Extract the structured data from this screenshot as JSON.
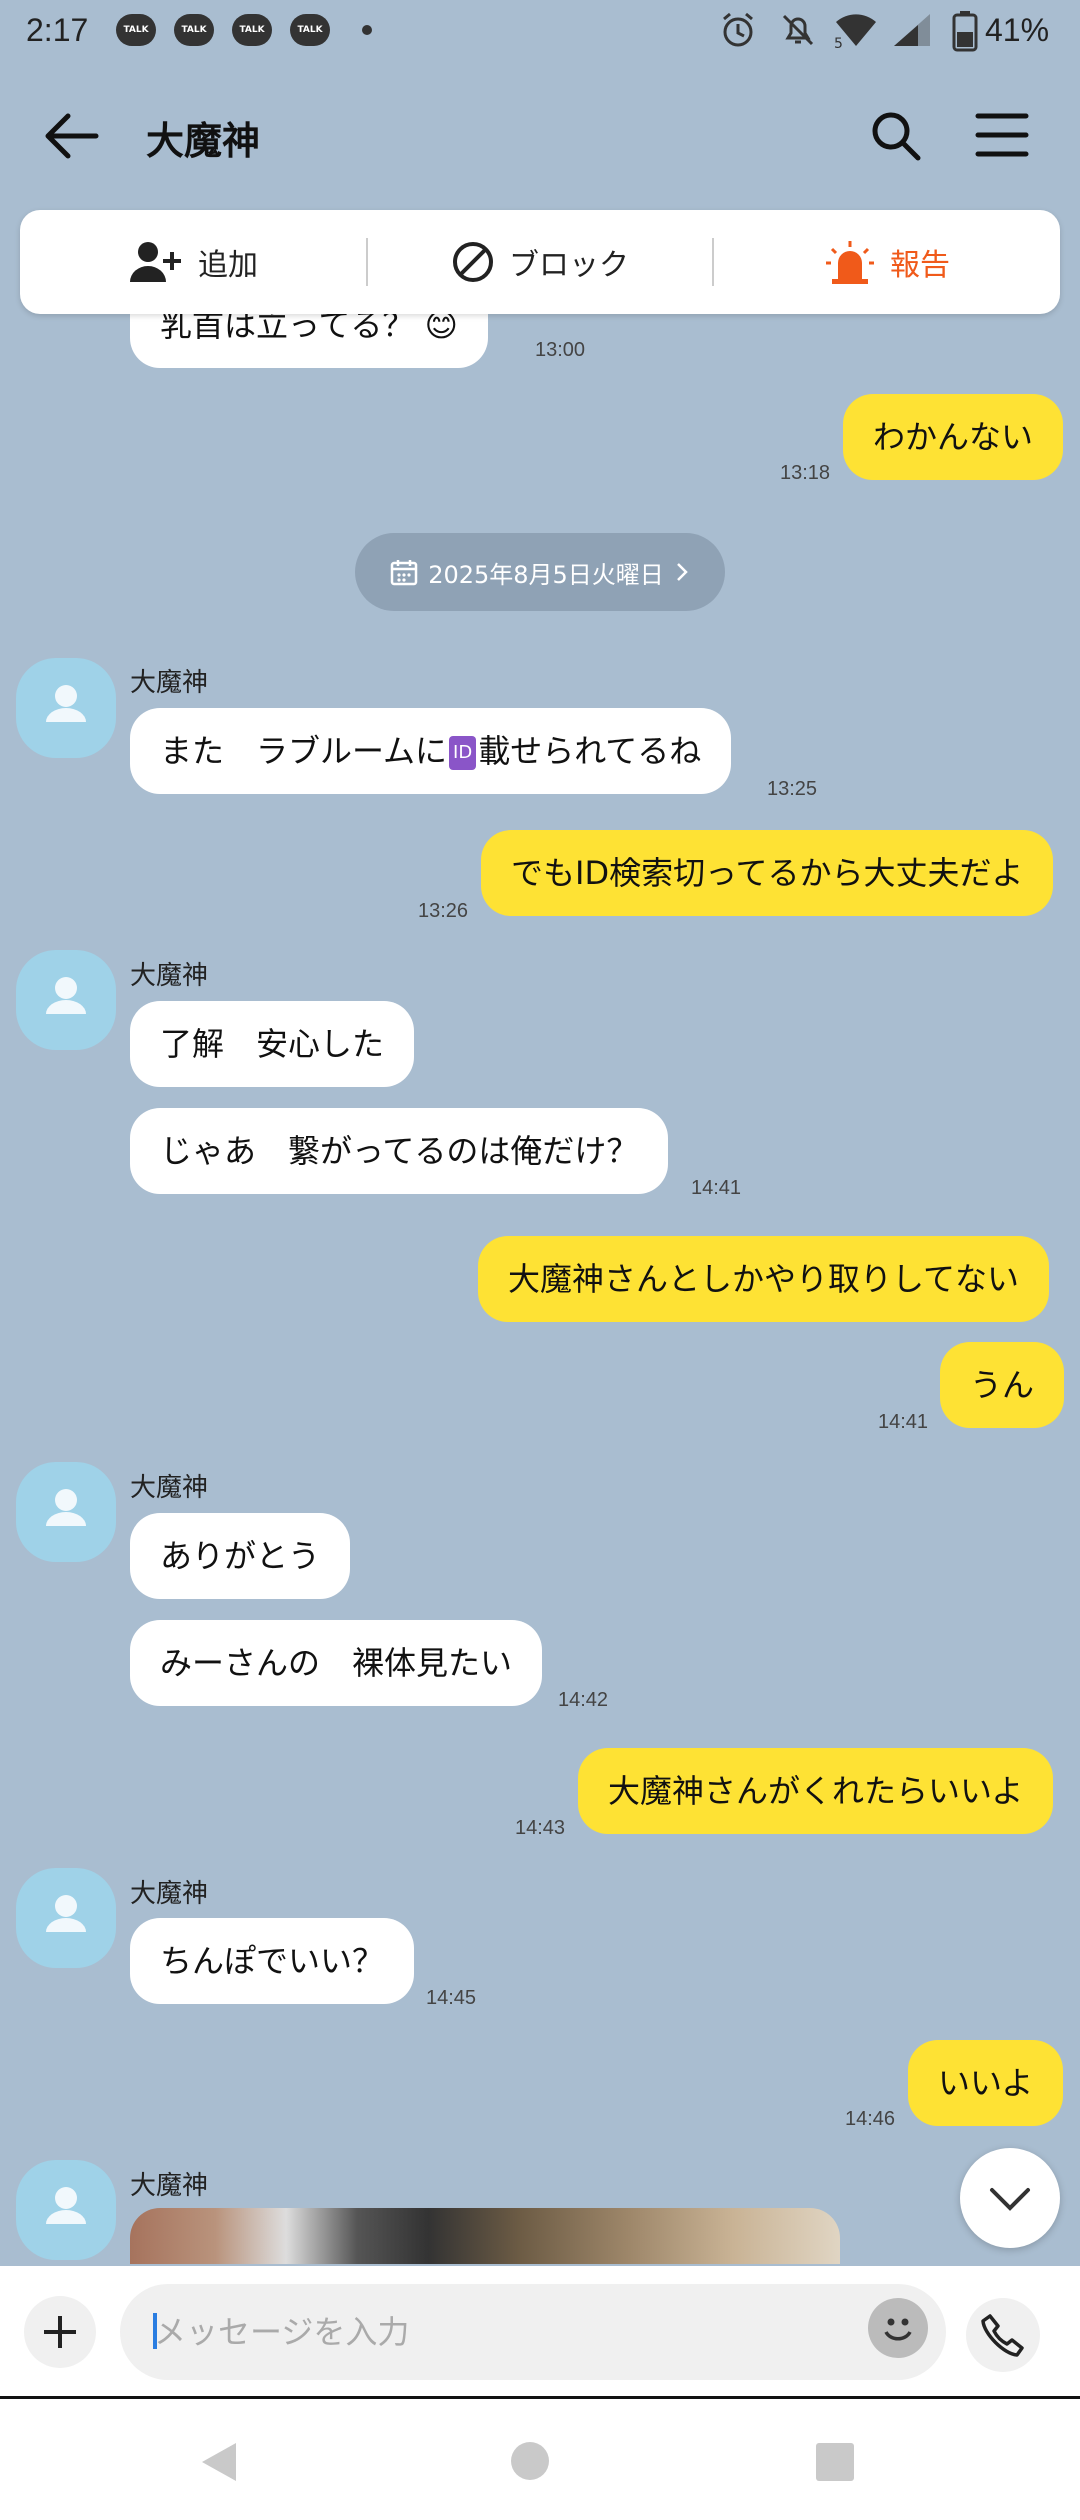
{
  "status": {
    "time": "2:17",
    "talk_label": "TALK",
    "battery": "41%"
  },
  "header": {
    "title": "大魔神"
  },
  "actions": {
    "add": "追加",
    "block": "ブロック",
    "report": "報告"
  },
  "date_pill": "2025年8月5日火曜日",
  "sender_name": "大魔神",
  "messages": {
    "m0": {
      "text": "乳首は立ってる？ 😊",
      "time": "13:00"
    },
    "m1": {
      "text": "わかんない",
      "time": "13:18"
    },
    "m2": {
      "before": "また　ラブルームに",
      "badge": "ID",
      "after": "載せられてるね",
      "time": "13:25"
    },
    "m3": {
      "text": "でもID検索切ってるから大丈夫だよ",
      "time": "13:26"
    },
    "m4": {
      "text": "了解　安心した"
    },
    "m5": {
      "text": "じゃあ　繋がってるのは俺だけ？",
      "time": "14:41"
    },
    "m6": {
      "text": "大魔神さんとしかやり取りしてない"
    },
    "m7": {
      "text": "うん",
      "time": "14:41"
    },
    "m8": {
      "text": "ありがとう"
    },
    "m9": {
      "text": "みーさんの　裸体見たい",
      "time": "14:42"
    },
    "m10": {
      "text": "大魔神さんがくれたらいいよ",
      "time": "14:43"
    },
    "m11": {
      "text": "ちんぽでいい？",
      "time": "14:45"
    },
    "m12": {
      "text": "いいよ",
      "time": "14:46"
    }
  },
  "input": {
    "placeholder": "メッセージを入力"
  },
  "colors": {
    "background": "#a9bdd0",
    "my_bubble": "#fee234",
    "report": "#f05a1a",
    "avatar": "#9fd2e8"
  }
}
